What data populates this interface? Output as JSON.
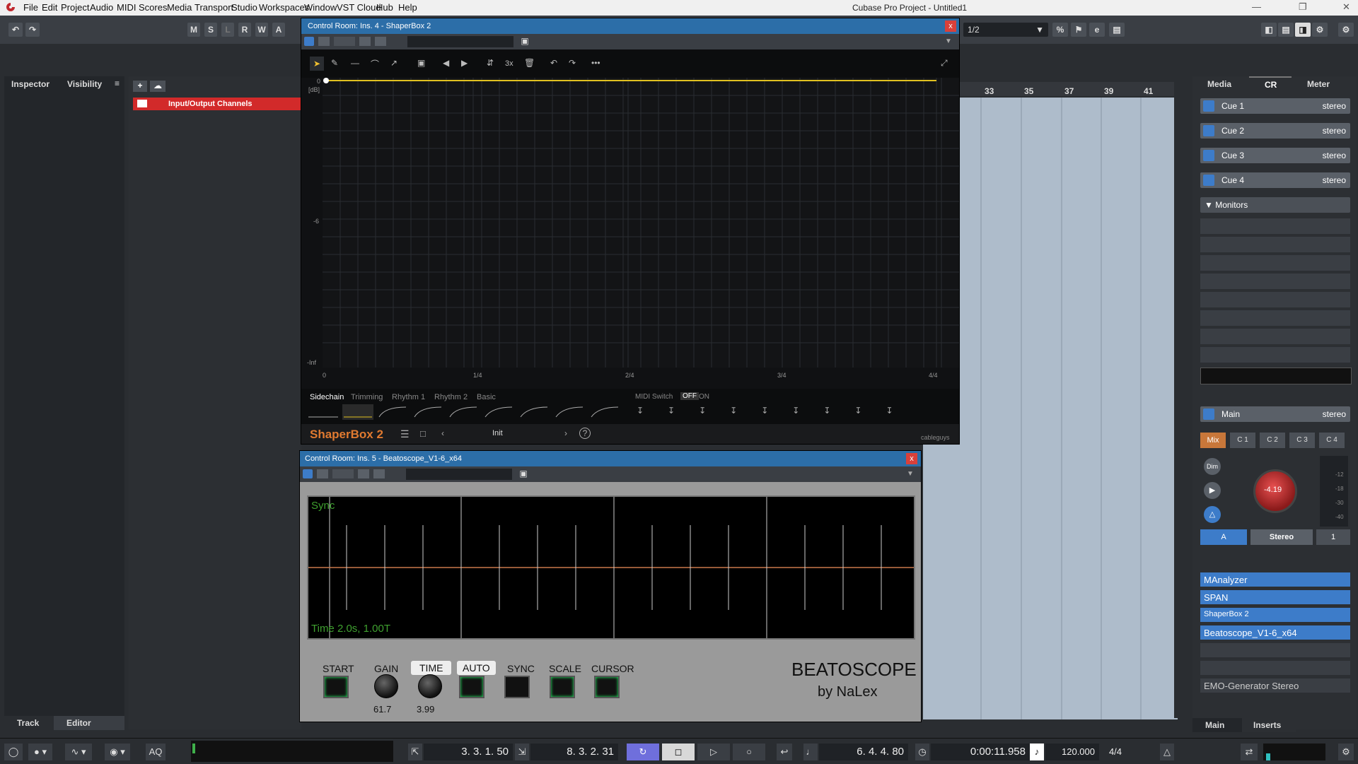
{
  "menu": [
    "File",
    "Edit",
    "Project",
    "Audio",
    "MIDI",
    "Scores",
    "Media",
    "Transport",
    "Studio",
    "Workspaces",
    "Window",
    "VST Cloud",
    "Hub",
    "Help"
  ],
  "window_title": "Cubase Pro Project - Untitled1",
  "toolbar": {
    "msrwa": [
      "M",
      "S",
      "L",
      "R",
      "W",
      "A"
    ],
    "quantize": "1/2"
  },
  "left": {
    "tab_inspector": "Inspector",
    "tab_visibility": "Visibility",
    "menu_glyph": "≡",
    "track_tab": "Track",
    "editor_tab": "Editor",
    "folder": "Input/Output Channels"
  },
  "ruler": [
    "33",
    "35",
    "37",
    "39",
    "41"
  ],
  "shaperbox": {
    "title": "Control Room: Ins. 4 - ShaperBox 2",
    "ylabels": {
      "top": "0",
      "db": "[dB]",
      "mid": "-6",
      "bottom": "-Inf"
    },
    "xlabels": [
      "0",
      "1/4",
      "2/4",
      "3/4",
      "4/4"
    ],
    "tabs": [
      "Sidechain",
      "Trimming",
      "Rhythm 1",
      "Rhythm 2",
      "Basic"
    ],
    "midi_switch": "MIDI Switch",
    "midi_off": "OFF",
    "midi_on": "ON",
    "brand": "ShaperBox 2",
    "preset": "Init",
    "tool_3x": "3x",
    "maker": "cableguys"
  },
  "beatoscope": {
    "title": "Control Room: Ins. 5 - Beatoscope_V1-6_x64",
    "sync_text": "Sync",
    "time_text": "Time 2.0s, 1.00T",
    "controls": [
      "START",
      "GAIN",
      "TIME",
      "AUTO",
      "SYNC",
      "SCALE",
      "CURSOR"
    ],
    "gain_value": "61.7",
    "time_value": "3.99",
    "brand": "BEATOSCOPE",
    "by": "by NaLex"
  },
  "cr": {
    "tabs": [
      "Media",
      "CR",
      "Meter"
    ],
    "cues": [
      {
        "name": "Cue 1",
        "type": "stereo"
      },
      {
        "name": "Cue 2",
        "type": "stereo"
      },
      {
        "name": "Cue 3",
        "type": "stereo"
      },
      {
        "name": "Cue 4",
        "type": "stereo"
      }
    ],
    "monitors": "▼ Monitors",
    "main": {
      "name": "Main",
      "type": "stereo"
    },
    "mix_buttons": [
      "Mix",
      "C 1",
      "C 2",
      "C 3",
      "C 4"
    ],
    "dim": "Dim",
    "knob_value": "-4.19",
    "a_btn": "A",
    "stereo_btn": "Stereo",
    "one_btn": "1",
    "inserts": [
      "MAnalyzer",
      "SPAN",
      "ShaperBox 2",
      "Beatoscope_V1-6_x64"
    ],
    "insert_empty": "EMO-Generator Stereo",
    "bottom_tabs": [
      "Main",
      "Inserts"
    ],
    "meter_ticks": [
      "-12",
      "-18",
      "-30",
      "-40"
    ]
  },
  "transport": {
    "aq": "AQ",
    "left_locator": "3. 3. 1. 50",
    "right_locator": "8. 3. 2. 31",
    "position": "6. 4. 4. 80",
    "time": "0:00:11.958",
    "tempo": "120.000",
    "signature": "4/4"
  }
}
